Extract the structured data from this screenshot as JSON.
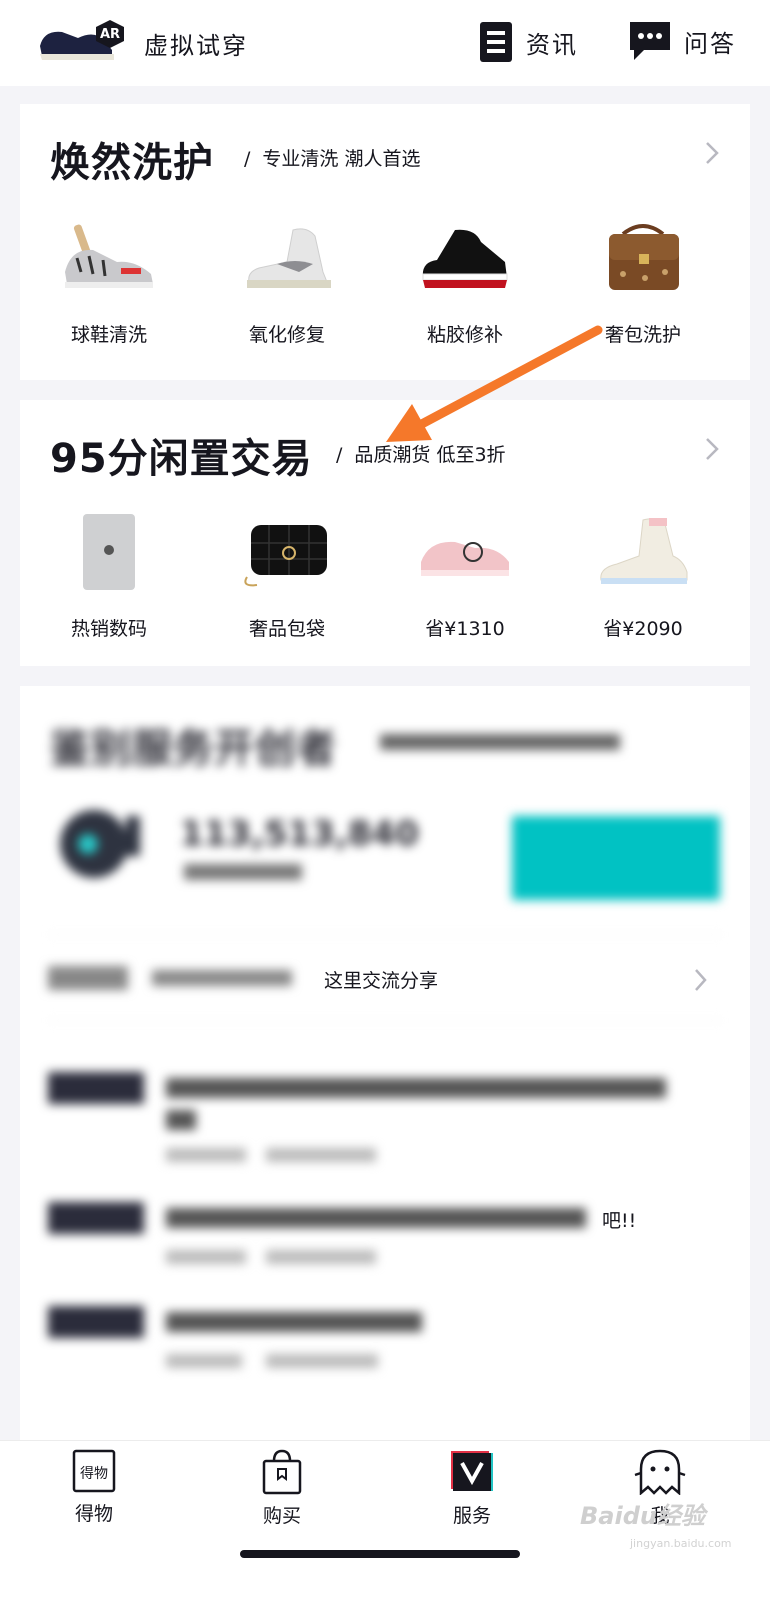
{
  "header": {
    "ar_badge": "AR",
    "ar_title": "虚拟试穿",
    "news_label": "资讯",
    "qa_label": "问答"
  },
  "care": {
    "title": "焕然洗护",
    "subtitle": "专业清洗 潮人首选",
    "items": [
      {
        "label": "球鞋清洗",
        "icon": "sneaker-cleaning-icon"
      },
      {
        "label": "氧化修复",
        "icon": "sneaker-restore-icon"
      },
      {
        "label": "粘胶修补",
        "icon": "sneaker-glue-icon"
      },
      {
        "label": "奢包洗护",
        "icon": "luxury-bag-icon"
      }
    ]
  },
  "resale": {
    "title": "95分闲置交易",
    "subtitle": "品质潮货 低至3折",
    "items": [
      {
        "label": "热销数码",
        "icon": "tablet-icon"
      },
      {
        "label": "奢品包袋",
        "icon": "handbag-icon"
      },
      {
        "label": "省¥1310",
        "icon": "pink-sneaker-icon"
      },
      {
        "label": "省¥2090",
        "icon": "white-sneaker-icon"
      }
    ]
  },
  "auth": {
    "title": "鉴别服务开创者",
    "count": "113,513,840",
    "discussion_visible": "这里交流分享",
    "post2_tail": "吧!!"
  },
  "tabbar": {
    "tabs": [
      {
        "label": "得物",
        "icon": "dewu-icon"
      },
      {
        "label": "购买",
        "icon": "shopping-bag-icon"
      },
      {
        "label": "服务",
        "icon": "service-icon"
      },
      {
        "label": "我",
        "icon": "ghost-icon"
      }
    ]
  },
  "watermark": {
    "brand": "Baidu经验",
    "url": "jingyan.baidu.com"
  },
  "colors": {
    "accent": "#01c2c3",
    "arrow": "#f5782a",
    "text": "#16161e"
  }
}
